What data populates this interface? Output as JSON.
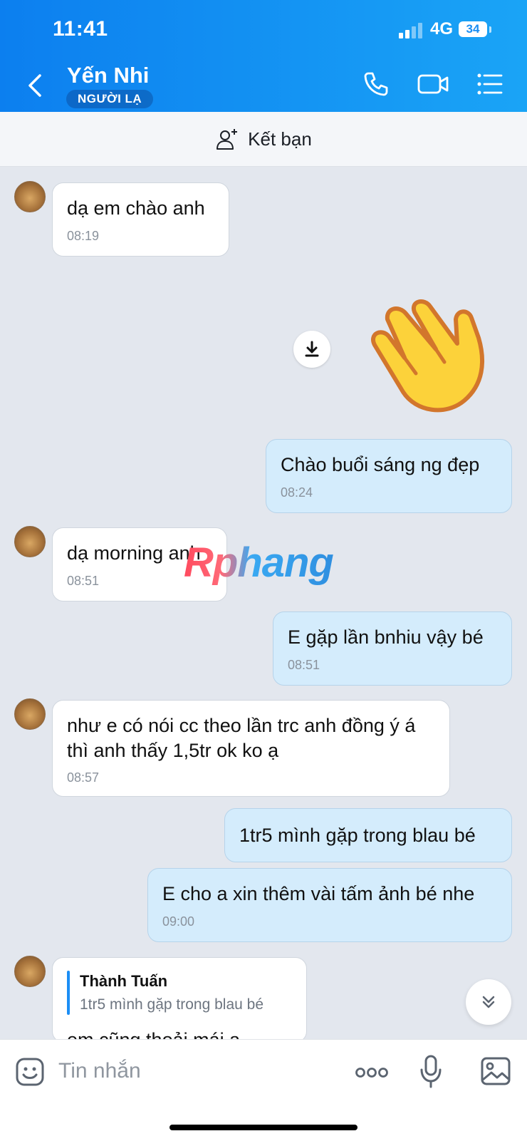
{
  "status_bar": {
    "time": "11:41",
    "network": "4G",
    "battery": "34"
  },
  "header": {
    "contact_name": "Yến Nhi",
    "tag": "NGƯỜI LẠ"
  },
  "friend_bar": {
    "label": "Kết bạn"
  },
  "watermark": "Rphang",
  "messages": [
    {
      "dir": "in",
      "text": "dạ em chào anh",
      "time": "08:19"
    },
    {
      "dir": "out",
      "text": "Chào buổi sáng ng đẹp",
      "time": "08:24"
    },
    {
      "dir": "in",
      "text": "dạ morning anh",
      "time": "08:51"
    },
    {
      "dir": "out",
      "text": "E gặp lần bnhiu vậy bé",
      "time": "08:51"
    },
    {
      "dir": "in",
      "text": "như e có nói cc theo lần trc anh đồng ý á thì anh thấy 1,5tr ok ko ạ",
      "time": "08:57"
    },
    {
      "dir": "out",
      "text": "1tr5 mình gặp trong blau bé",
      "time": ""
    },
    {
      "dir": "out",
      "text": "E cho a xin thêm vài tấm ảnh bé nhe",
      "time": "09:00"
    }
  ],
  "quoted_message": {
    "author": "Thành Tuấn",
    "quoted_text": "1tr5 mình gặp trong blau bé",
    "reply_partial": "em cũng thoải mái ạ"
  },
  "composer": {
    "placeholder": "Tin nhắn"
  },
  "icons": [
    "back-icon",
    "phone-icon",
    "video-call-icon",
    "menu-icon",
    "add-friend-icon",
    "download-icon",
    "waving-hand-sticker",
    "chevron-down-icon",
    "emoji-icon",
    "more-icon",
    "microphone-icon",
    "image-icon"
  ]
}
